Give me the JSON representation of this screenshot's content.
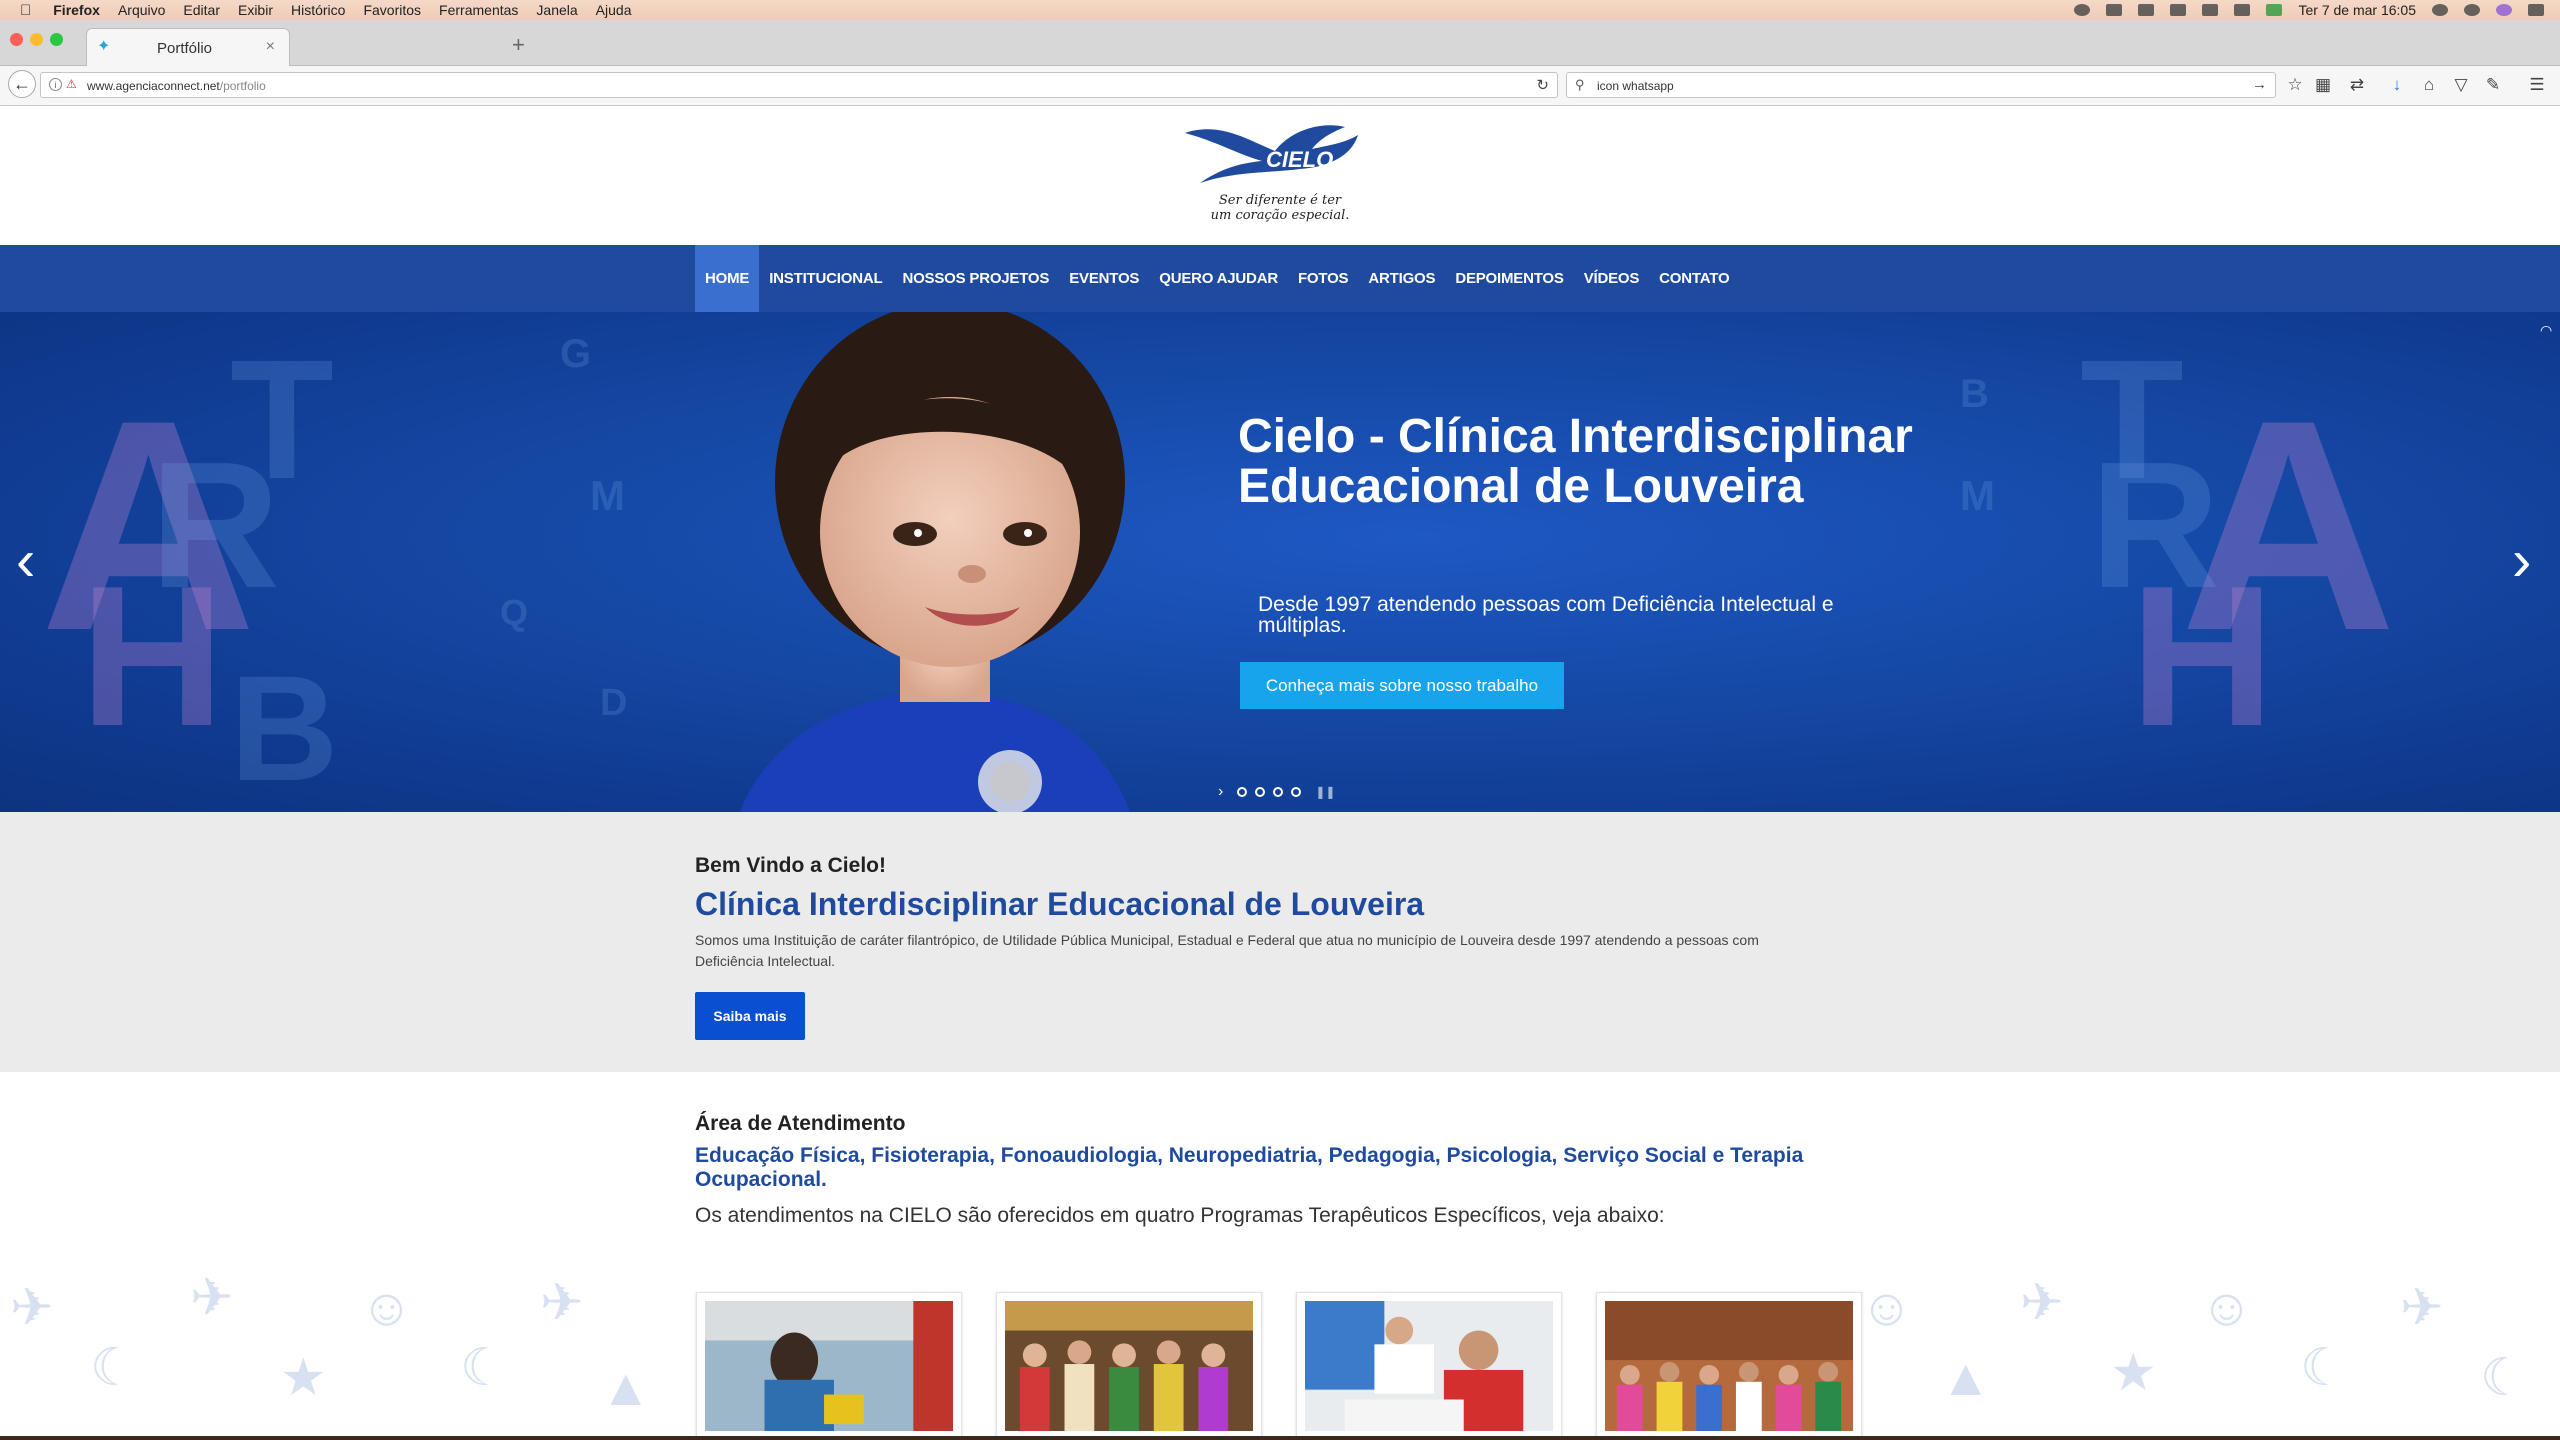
{
  "menubar": {
    "app": "Firefox",
    "items": [
      "Arquivo",
      "Editar",
      "Exibir",
      "Histórico",
      "Favoritos",
      "Ferramentas",
      "Janela",
      "Ajuda"
    ],
    "clock": "Ter 7 de mar  16:05"
  },
  "browser": {
    "tab_title": "Portfólio",
    "url_host": "www.agenciaconnect.net",
    "url_path": "/portfolio",
    "search_query": "icon whatsapp"
  },
  "site": {
    "logo_tagline": "Ser diferente é ter um coração especial.",
    "logo_word": "CIELO",
    "nav": [
      "HOME",
      "INSTITUCIONAL",
      "NOSSOS PROJETOS",
      "EVENTOS",
      "QUERO AJUDAR",
      "FOTOS",
      "ARTIGOS",
      "DEPOIMENTOS",
      "VÍDEOS",
      "CONTATO"
    ],
    "hero": {
      "title": "Cielo - Clínica Interdisciplinar Educacional de Louveira",
      "subtitle": "Desde 1997 atendendo pessoas com Deficiência Intelectual e múltiplas.",
      "button": "Conheça mais sobre nosso trabalho"
    },
    "welcome": {
      "kicker": "Bem Vindo a Cielo!",
      "title": "Clínica Interdisciplinar Educacional de Louveira",
      "body": "Somos uma Instituição de caráter filantrópico, de Utilidade Pública Municipal, Estadual e Federal que atua no município de Louveira desde 1997 atendendo a pessoas com Deficiência Intelectual.",
      "button": "Saiba mais"
    },
    "area": {
      "heading": "Área de Atendimento",
      "specialties": "Educação Física, Fisioterapia, Fonoaudiologia, Neuropediatria, Pedagogia, Psicologia, Serviço Social e Terapia Ocupacional.",
      "description": "Os atendimentos na CIELO são oferecidos em quatro Programas Terapêuticos Específicos, veja abaixo:"
    }
  },
  "colors": {
    "brand_blue": "#1f4a9e",
    "hero_button": "#16a5ec",
    "cta_blue": "#0b4fd1"
  }
}
